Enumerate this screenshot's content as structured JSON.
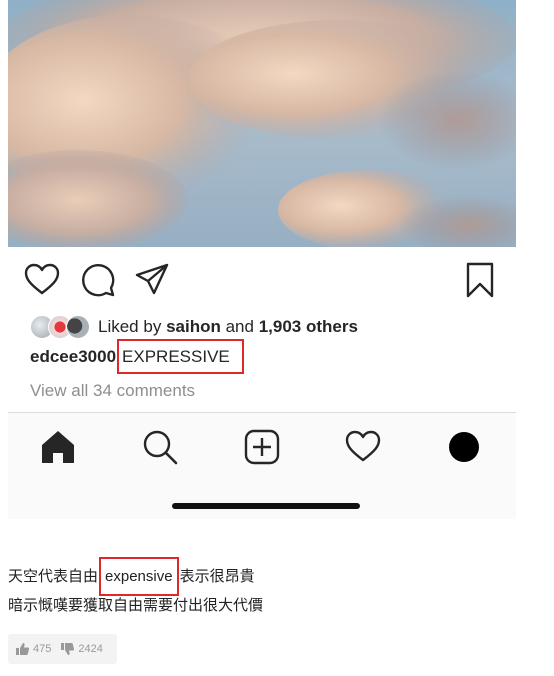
{
  "post": {
    "image_name": "sky-clouds-photo",
    "likes": {
      "prefix": "Liked by",
      "user": "saihon",
      "and": "and",
      "others": "1,903 others"
    },
    "caption": {
      "username": "edcee3000",
      "text": "EXPRESSIVE"
    },
    "view_comments": "View all 34 comments",
    "actions": [
      "heart-icon",
      "comment-icon",
      "share-icon",
      "bookmark-icon"
    ]
  },
  "tab_bar": {
    "items": [
      "home-icon",
      "search-icon",
      "new-post-icon",
      "activity-icon",
      "profile-icon"
    ]
  },
  "comment": {
    "line1_before": "天空代表自由",
    "line1_highlight": "expensive",
    "line1_after": "表示很昂貴",
    "line2": "暗示慨嘆要獲取自由需要付出很大代價"
  },
  "votes": {
    "up_count": "475",
    "down_count": "2424"
  },
  "colors": {
    "highlight_border": "#e0282b",
    "text_primary": "#262626",
    "text_secondary": "#8e8e8e"
  }
}
